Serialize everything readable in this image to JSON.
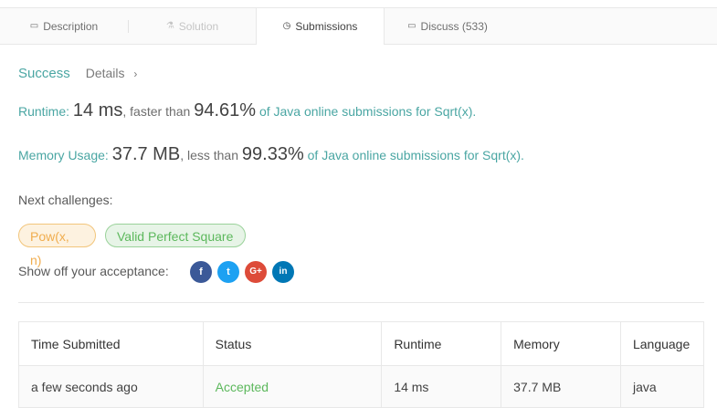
{
  "tabs": [
    {
      "icon": "▭",
      "label": "Description"
    },
    {
      "icon": "⚗",
      "label": "Solution"
    },
    {
      "icon": "◷",
      "label": "Submissions"
    },
    {
      "icon": "▭",
      "label": "Discuss (533)"
    }
  ],
  "result": {
    "status": "Success",
    "details_label": "Details",
    "chevron": "›"
  },
  "runtime": {
    "label": "Runtime: ",
    "value": "14 ms",
    "compare": ", faster than ",
    "percent": "94.61%",
    "suffix": " of Java online submissions for Sqrt(x)."
  },
  "memory": {
    "label": "Memory Usage: ",
    "value": "37.7 MB",
    "compare": ", less than ",
    "percent": "99.33%",
    "suffix": " of Java online submissions for Sqrt(x)."
  },
  "next_challenges": {
    "label": "Next challenges:",
    "items": [
      {
        "label": "Pow(x, n)",
        "difficulty": "medium"
      },
      {
        "label": "Valid Perfect Square",
        "difficulty": "easy"
      }
    ]
  },
  "share": {
    "label": "Show off your acceptance:",
    "icons": [
      {
        "name": "facebook-icon",
        "glyph": "f"
      },
      {
        "name": "twitter-icon",
        "glyph": "t"
      },
      {
        "name": "google-plus-icon",
        "glyph": "G+"
      },
      {
        "name": "linkedin-icon",
        "glyph": "in"
      }
    ]
  },
  "table": {
    "headers": [
      "Time Submitted",
      "Status",
      "Runtime",
      "Memory",
      "Language"
    ],
    "rows": [
      [
        "a few seconds ago",
        "Accepted",
        "14 ms",
        "37.7 MB",
        "java"
      ]
    ]
  },
  "colors": {
    "accent": "#4aa6a3",
    "accepted": "#5cb85c",
    "medium": "#f0ad4e"
  }
}
